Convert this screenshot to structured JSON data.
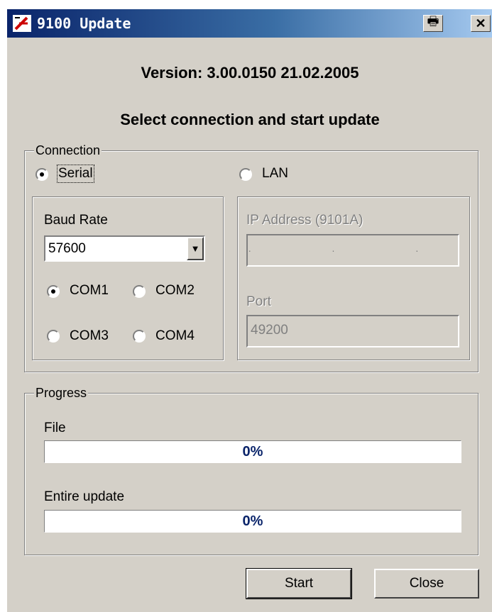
{
  "window": {
    "title": "9100 Update",
    "titlebar_colors": [
      "#0a246a",
      "#a6caf0"
    ]
  },
  "header": {
    "version": "Version: 3.00.0150  21.02.2005",
    "instruction": "Select connection and start update"
  },
  "connection": {
    "legend": "Connection",
    "serial_label": "Serial",
    "serial_selected": true,
    "lan_label": "LAN",
    "lan_selected": false,
    "serial": {
      "baud_label": "Baud Rate",
      "baud_value": "57600",
      "ports": [
        {
          "label": "COM1",
          "selected": true
        },
        {
          "label": "COM2",
          "selected": false
        },
        {
          "label": "COM3",
          "selected": false
        },
        {
          "label": "COM4",
          "selected": false
        }
      ]
    },
    "lan": {
      "ip_label": "IP Address (9101A)",
      "ip_value": ".  .  .",
      "port_label": "Port",
      "port_value": "49200"
    }
  },
  "progress": {
    "legend": "Progress",
    "file_label": "File",
    "file_percent": "0%",
    "file_fraction": 0,
    "entire_label": "Entire update",
    "entire_percent": "0%",
    "entire_fraction": 0
  },
  "buttons": {
    "start": "Start",
    "close": "Close"
  }
}
